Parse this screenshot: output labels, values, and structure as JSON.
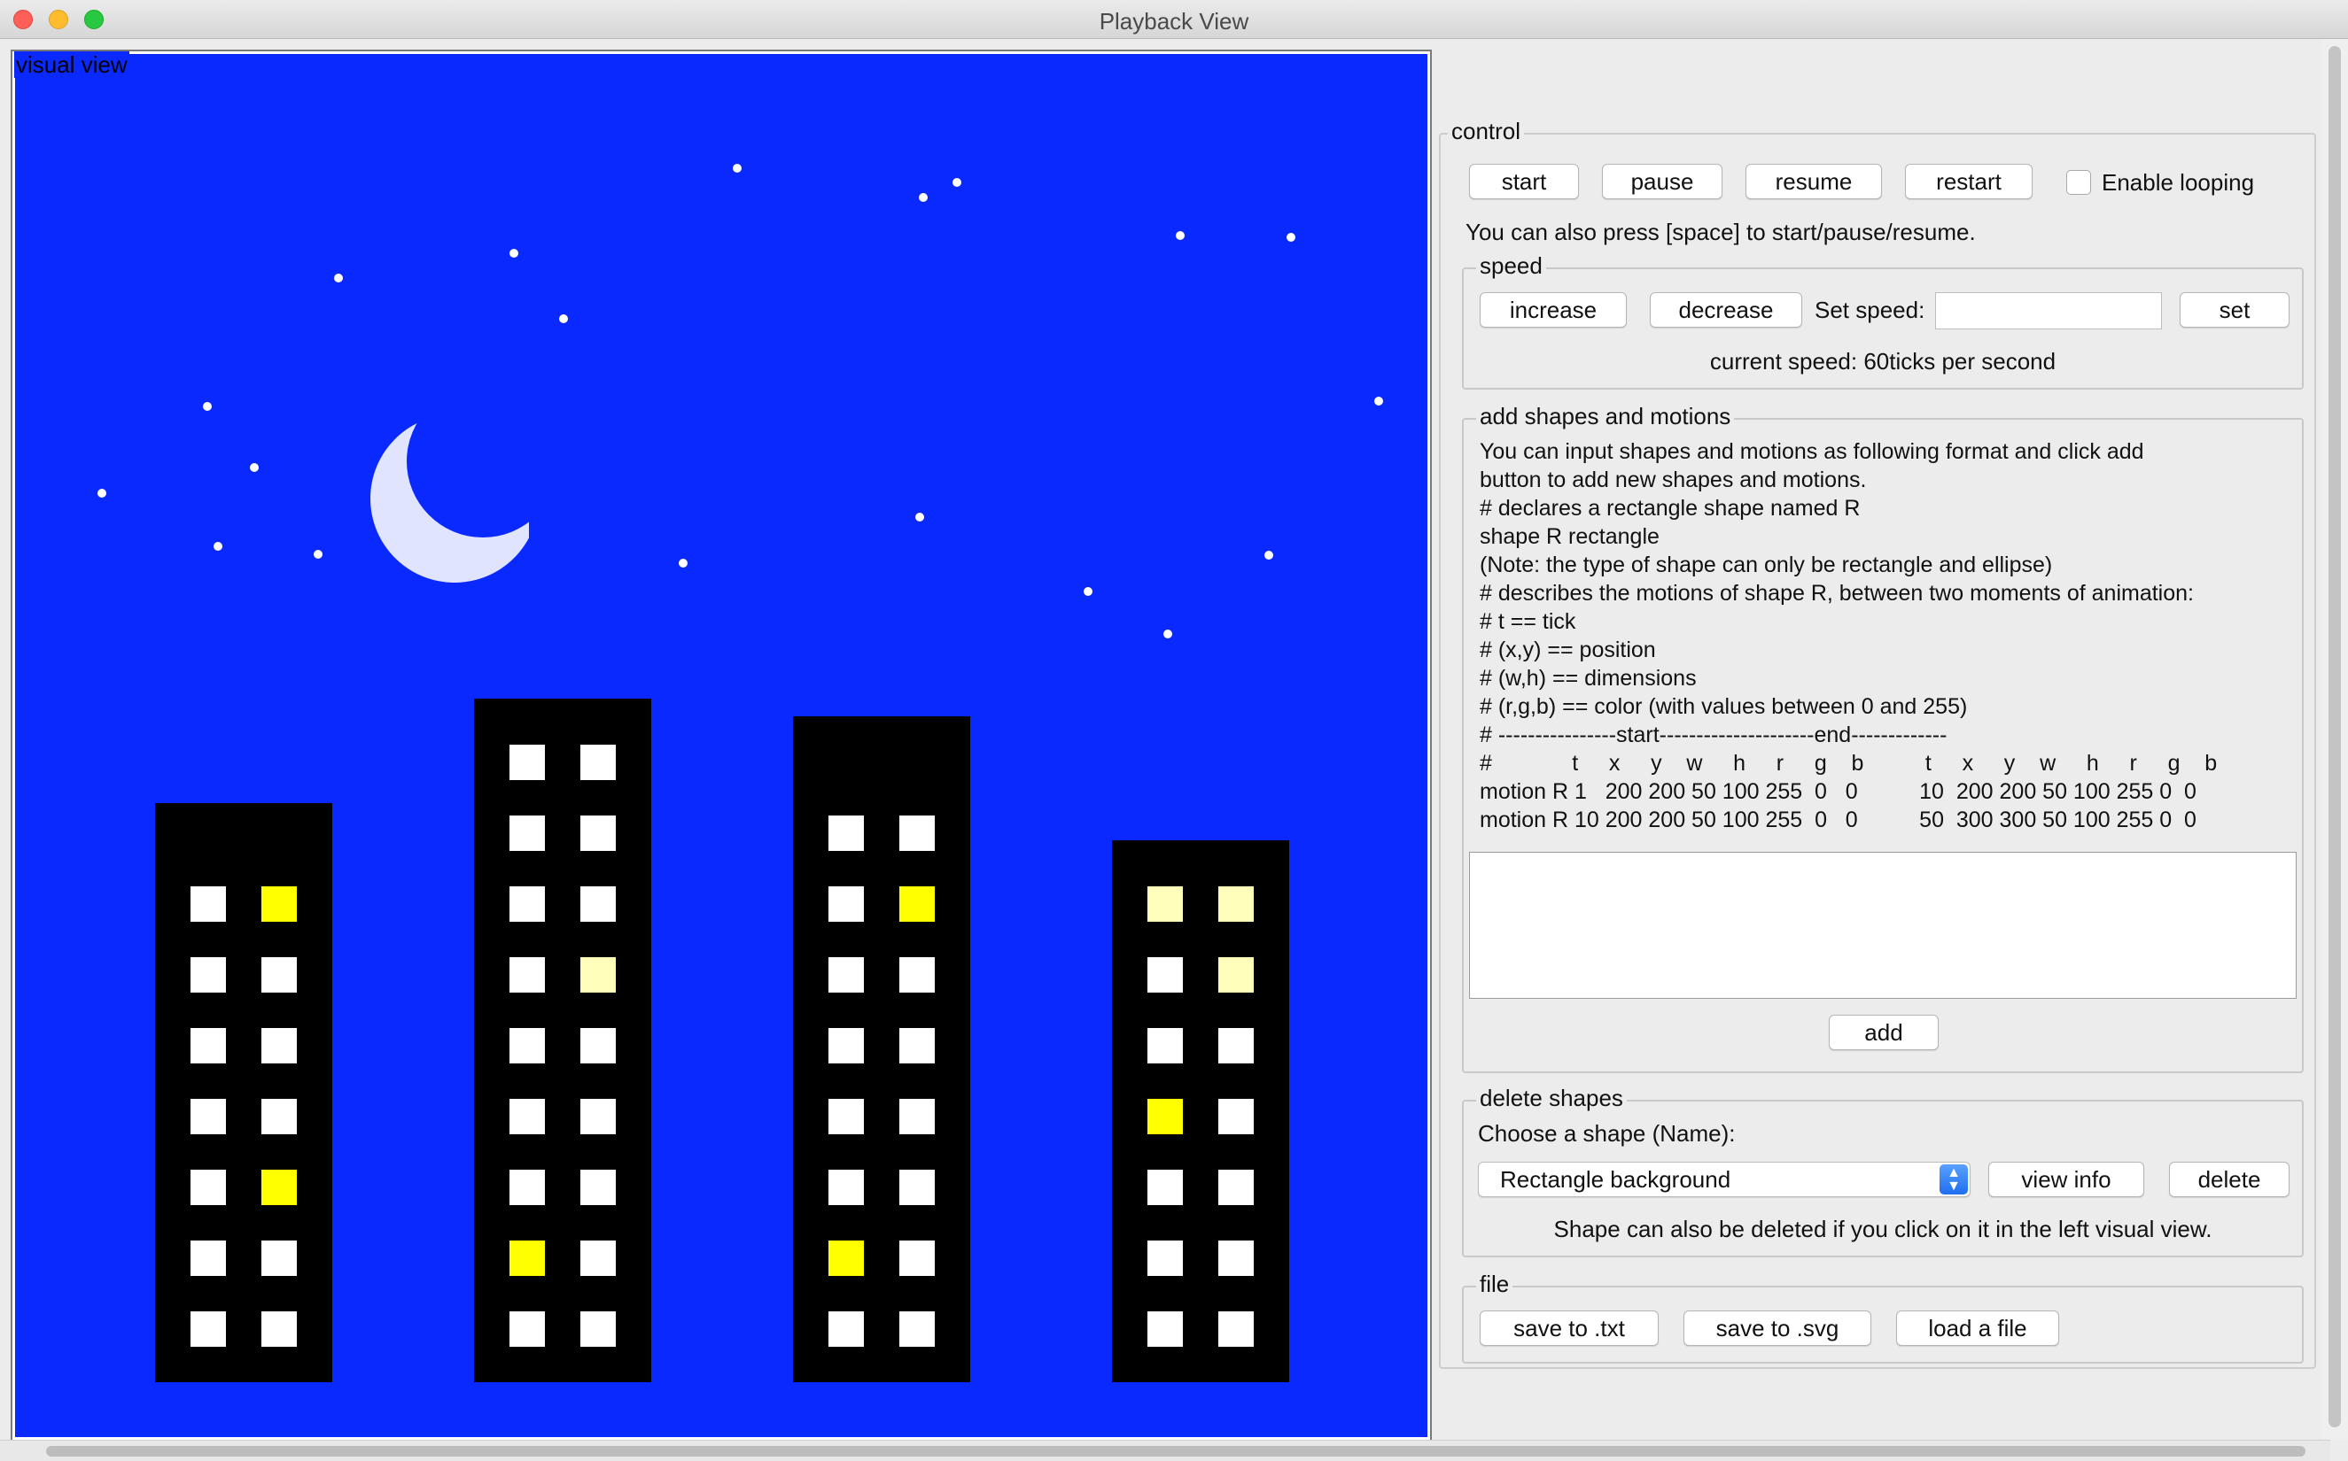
{
  "window": {
    "title": "Playback View"
  },
  "visual_view": {
    "label": "visual view",
    "colors": {
      "sky": "#0a29ff",
      "moon": "#e0e4ff",
      "star": "#ffffff",
      "building": "#000000",
      "window_off": "#ffffff",
      "window_lit": "#ffff00",
      "window_dim": "#ffffbb"
    },
    "buildings": [
      {
        "name": "building-1",
        "windows": [
          [
            "white",
            "lit"
          ],
          [
            "white",
            "white"
          ],
          [
            "white",
            "white"
          ],
          [
            "white",
            "white"
          ],
          [
            "white",
            "lit"
          ],
          [
            "white",
            "white"
          ],
          [
            "white",
            "white"
          ]
        ]
      },
      {
        "name": "building-2",
        "windows": [
          [
            "white",
            "white"
          ],
          [
            "white",
            "white"
          ],
          [
            "white",
            "white"
          ],
          [
            "white",
            "dim"
          ],
          [
            "white",
            "white"
          ],
          [
            "white",
            "white"
          ],
          [
            "white",
            "white"
          ],
          [
            "lit",
            "white"
          ],
          [
            "white",
            "white"
          ]
        ]
      },
      {
        "name": "building-3",
        "windows": [
          [
            "white",
            "white"
          ],
          [
            "white",
            "lit"
          ],
          [
            "white",
            "white"
          ],
          [
            "white",
            "white"
          ],
          [
            "white",
            "white"
          ],
          [
            "white",
            "white"
          ],
          [
            "lit",
            "white"
          ],
          [
            "white",
            "white"
          ]
        ]
      },
      {
        "name": "building-4",
        "windows": [
          [
            "dim",
            "dim"
          ],
          [
            "white",
            "dim"
          ],
          [
            "white",
            "white"
          ],
          [
            "lit",
            "white"
          ],
          [
            "white",
            "white"
          ],
          [
            "white",
            "white"
          ],
          [
            "white",
            "white"
          ]
        ]
      }
    ]
  },
  "control": {
    "legend": "control",
    "start_label": "start",
    "pause_label": "pause",
    "resume_label": "resume",
    "restart_label": "restart",
    "looping_label": "Enable looping",
    "looping_checked": false,
    "hint": "You can also press [space] to start/pause/resume."
  },
  "speed": {
    "legend": "speed",
    "increase_label": "increase",
    "decrease_label": "decrease",
    "set_speed_label": "Set speed:",
    "set_speed_value": "",
    "set_label": "set",
    "current_speed": "current speed: 60ticks per second"
  },
  "add_shapes": {
    "legend": "add shapes and motions",
    "instructions": "You can input shapes and motions as following format and click add\nbutton to add new shapes and motions.\n# declares a rectangle shape named R\nshape R rectangle\n(Note: the type of shape can only be rectangle and ellipse)\n# describes the motions of shape R, between two moments of animation:\n# t == tick\n# (x,y) == position\n# (w,h) == dimensions\n# (r,g,b) == color (with values between 0 and 255)\n# ----------------start---------------------end-------------\n#             t     x     y    w     h     r     g    b          t     x     y    w     h     r     g    b\nmotion R 1   200 200 50 100 255  0   0          10  200 200 50 100 255 0  0\nmotion R 10 200 200 50 100 255  0   0          50  300 300 50 100 255 0  0",
    "input_value": "",
    "add_label": "add"
  },
  "delete_shapes": {
    "legend": "delete shapes",
    "choose_label": "Choose a shape (Name):",
    "selected_shape": "Rectangle background",
    "view_info_label": "view info",
    "delete_label": "delete",
    "hint": "Shape can also be deleted if you click on it in the left visual view."
  },
  "file": {
    "legend": "file",
    "save_txt_label": "save to .txt",
    "save_svg_label": "save to .svg",
    "load_label": "load a file"
  }
}
